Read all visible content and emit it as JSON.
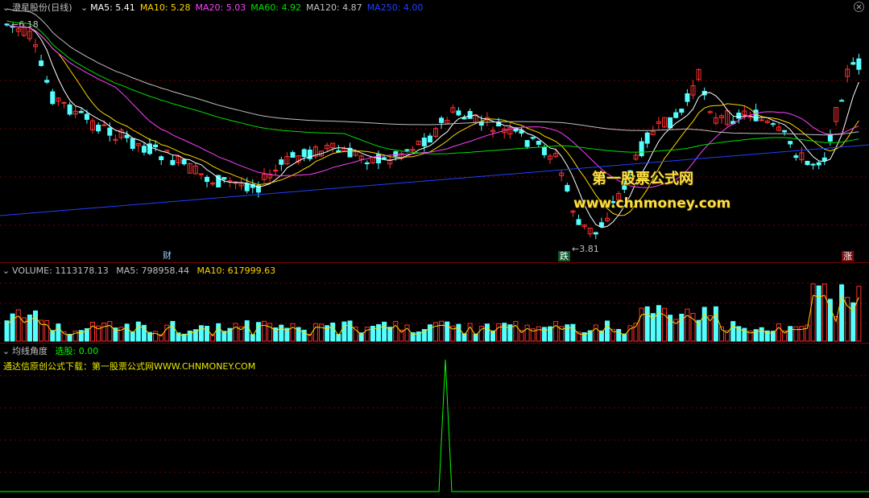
{
  "main": {
    "title": "澄星股份(日线)",
    "ma": [
      {
        "label": "MA5: 5.41",
        "color": "#ffffff"
      },
      {
        "label": "MA10: 5.28",
        "color": "#ffd700"
      },
      {
        "label": "MA20: 5.03",
        "color": "#ff40ff"
      },
      {
        "label": "MA60: 4.92",
        "color": "#00e000"
      },
      {
        "label": "MA120: 4.87",
        "color": "#c0c0c0"
      },
      {
        "label": "MA250: 4.00",
        "color": "#2040ff"
      }
    ],
    "high_label": "6.18",
    "low_label": "3.81",
    "badges": {
      "cai": "财",
      "die": "跌",
      "zhang": "涨"
    },
    "watermark1": "第一股票公式网",
    "watermark2": "www.chnmoney.com"
  },
  "volume": {
    "title": "VOLUME: 1113178.13",
    "ma5": "MA5: 798958.44",
    "ma10": "MA10: 617999.63"
  },
  "indicator": {
    "title": "均线角度",
    "select": "选股: 0.00",
    "download": "通达信原创公式下载：第一股票公式网WWW.CHNMONEY.COM"
  },
  "colors": {
    "up": "#ff3030",
    "down": "#54ffff",
    "grid": "#7a0000",
    "signal": "#00ff00"
  }
}
